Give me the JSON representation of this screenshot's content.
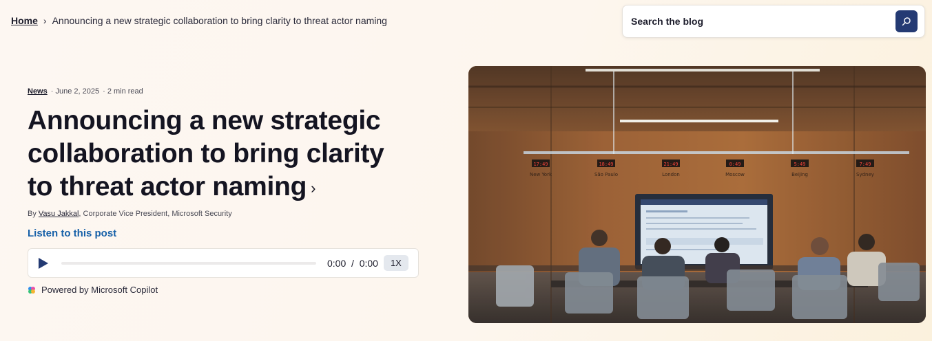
{
  "breadcrumb": {
    "home": "Home",
    "current": "Announcing a new strategic collaboration to bring clarity to threat actor naming"
  },
  "search": {
    "placeholder": "Search the blog"
  },
  "article": {
    "category": "News",
    "date": "· June 2, 2025",
    "read_time": "· 2 min read",
    "title": "Announcing a new strategic collaboration to bring clarity to threat actor naming",
    "byline_prefix": "By ",
    "author": "Vasu Jakkal",
    "author_role": ", Corporate Vice President, Microsoft Security"
  },
  "audio": {
    "listen_label": "Listen to this post",
    "current_time": "0:00",
    "separator": "/",
    "duration": "0:00",
    "speed": "1X",
    "progress": 0,
    "powered_by": "Powered by Microsoft Copilot"
  },
  "hero_image": {
    "clocks": [
      {
        "time": "17:49",
        "city": "New York"
      },
      {
        "time": "18:49",
        "city": "São Paulo"
      },
      {
        "time": "21:49",
        "city": "London"
      },
      {
        "time": "0:49",
        "city": "Moscow"
      },
      {
        "time": "5:49",
        "city": "Beijing"
      },
      {
        "time": "7:49",
        "city": "Sydney"
      }
    ]
  },
  "colors": {
    "accent": "#243a73",
    "link": "#1660a8",
    "text": "#141421"
  }
}
